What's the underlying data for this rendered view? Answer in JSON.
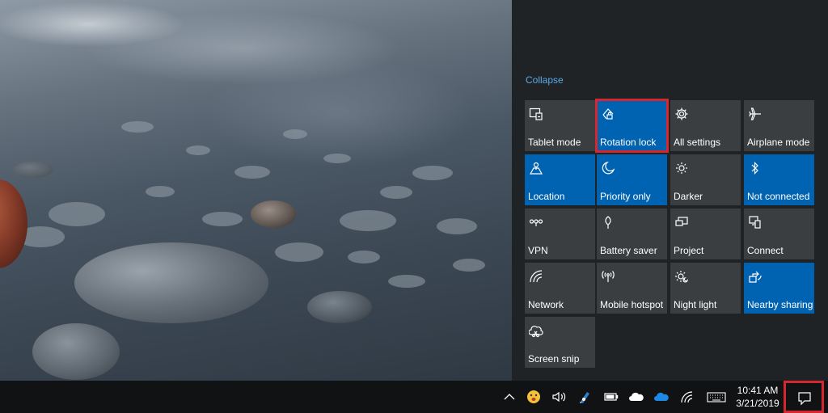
{
  "action_center": {
    "collapse_label": "Collapse",
    "tiles": [
      {
        "label": "Tablet mode",
        "icon": "tablet-mode-icon",
        "active": false
      },
      {
        "label": "Rotation lock",
        "icon": "rotation-lock-icon",
        "active": true
      },
      {
        "label": "All settings",
        "icon": "gear-icon",
        "active": false
      },
      {
        "label": "Airplane mode",
        "icon": "airplane-icon",
        "active": false
      },
      {
        "label": "Location",
        "icon": "location-icon",
        "active": true
      },
      {
        "label": "Priority only",
        "icon": "moon-icon",
        "active": true
      },
      {
        "label": "Darker",
        "icon": "sun-icon",
        "active": false
      },
      {
        "label": "Not connected",
        "icon": "bluetooth-icon",
        "active": true
      },
      {
        "label": "VPN",
        "icon": "vpn-icon",
        "active": false
      },
      {
        "label": "Battery saver",
        "icon": "battery-saver-icon",
        "active": false
      },
      {
        "label": "Project",
        "icon": "project-icon",
        "active": false
      },
      {
        "label": "Connect",
        "icon": "connect-icon",
        "active": false
      },
      {
        "label": "Network",
        "icon": "network-icon",
        "active": false
      },
      {
        "label": "Mobile hotspot",
        "icon": "hotspot-icon",
        "active": false
      },
      {
        "label": "Night light",
        "icon": "night-light-icon",
        "active": false
      },
      {
        "label": "Nearby sharing",
        "icon": "nearby-sharing-icon",
        "active": true
      },
      {
        "label": "Screen snip",
        "icon": "screen-snip-icon",
        "active": false
      }
    ]
  },
  "taskbar": {
    "time": "10:41 AM",
    "date": "3/21/2019"
  },
  "colors": {
    "accent": "#0063b1",
    "tile_off": "#3b3e41",
    "highlight": "#d6262e",
    "link": "#5aa9e6"
  }
}
